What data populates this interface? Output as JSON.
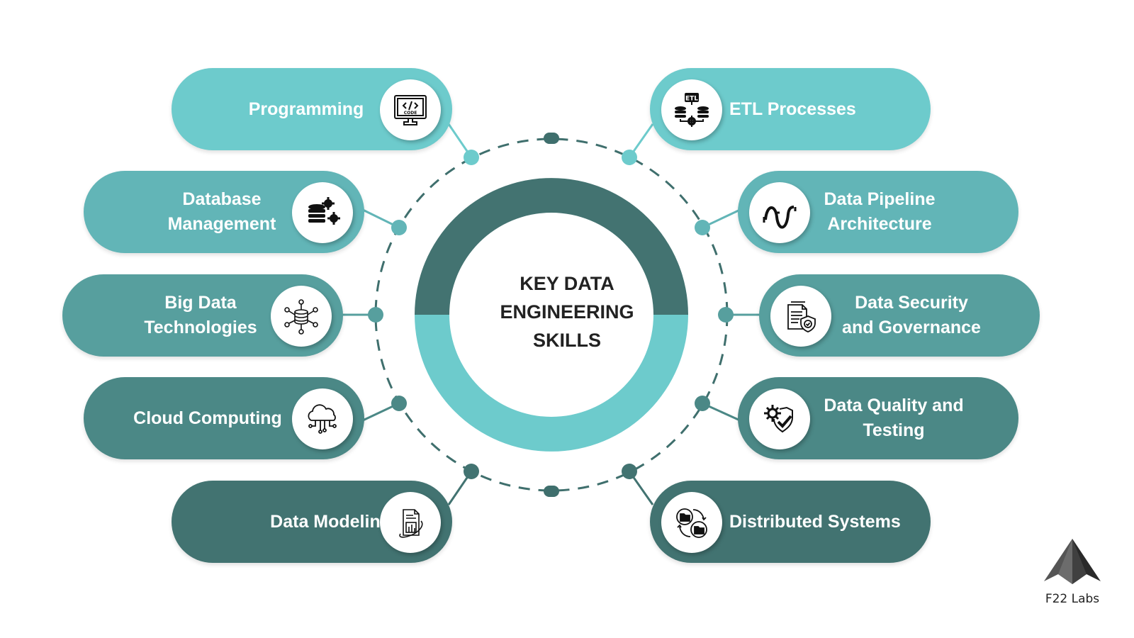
{
  "title": "KEY DATA\nENGINEERING\n SKILLS",
  "colors": {
    "row1": "#6dcbcc",
    "row2": "#62b5b7",
    "row3": "#579f9e",
    "row4": "#4b8886",
    "row5": "#427371",
    "ring_top": "#437371",
    "ring_bottom": "#6dcbcc",
    "dash": "#3f6f6d"
  },
  "skills_left": [
    {
      "label": "Programming",
      "icon": "code-monitor-icon"
    },
    {
      "label": "Database\nManagement",
      "icon": "database-gear-icon"
    },
    {
      "label": "Big Data\nTechnologies",
      "icon": "database-network-icon"
    },
    {
      "label": "Cloud Computing",
      "icon": "cloud-network-icon"
    },
    {
      "label": "Data Modeling",
      "icon": "report-chart-icon"
    }
  ],
  "skills_right": [
    {
      "label": "ETL Processes",
      "icon": "etl-database-icon"
    },
    {
      "label": "Data Pipeline\nArchitecture",
      "icon": "pipeline-icon"
    },
    {
      "label": "Data Security\nand Governance",
      "icon": "document-shield-icon"
    },
    {
      "label": "Data Quality and\nTesting",
      "icon": "gear-shield-check-icon"
    },
    {
      "label": "Distributed Systems",
      "icon": "folder-sync-icon"
    }
  ],
  "brand": {
    "name": "F22 Labs",
    "icon": "f22-logo-icon"
  }
}
